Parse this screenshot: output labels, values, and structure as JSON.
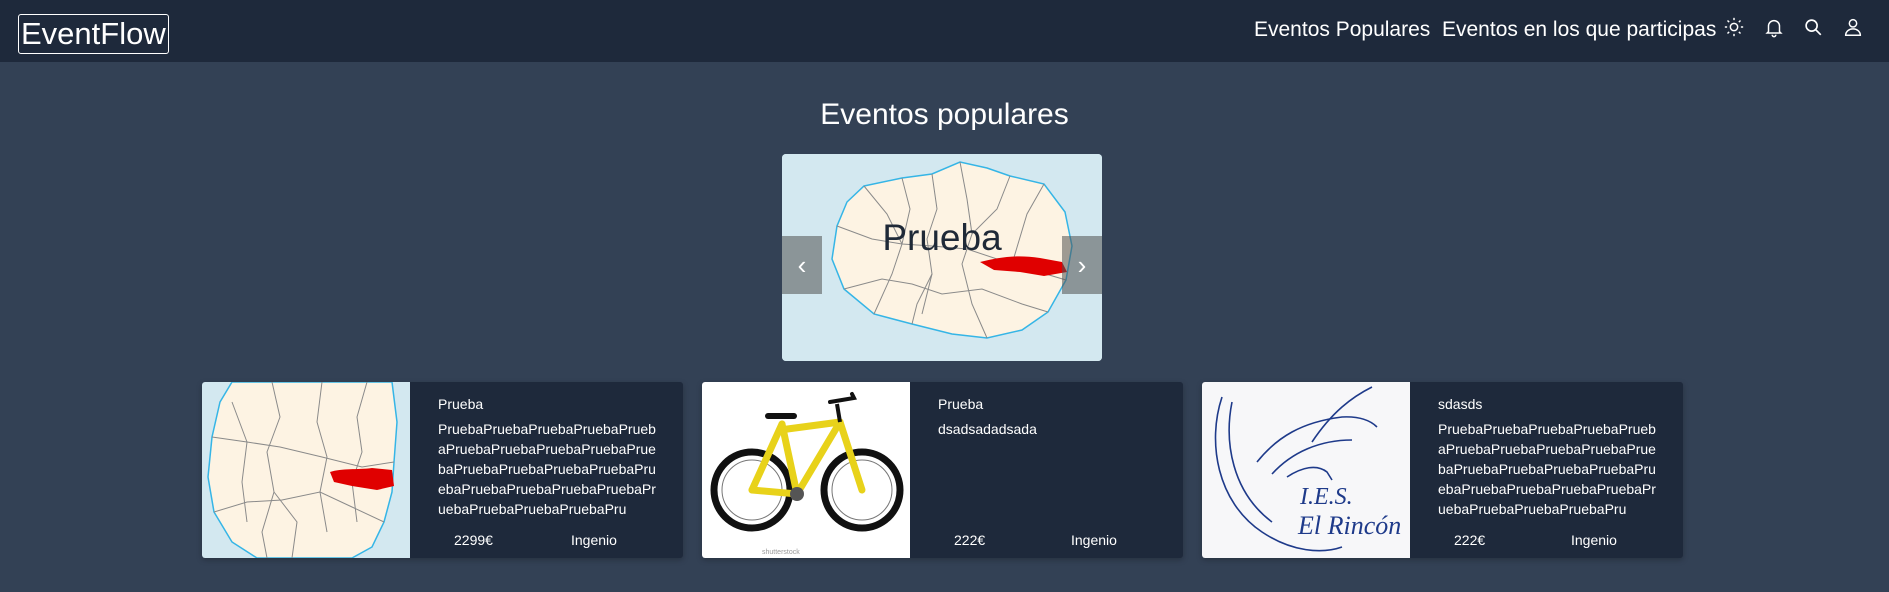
{
  "navbar": {
    "brand": "EventFlow",
    "links": [
      "Eventos Populares",
      "Eventos en los que participas"
    ],
    "icons": [
      "sun-icon",
      "bell-icon",
      "search-icon",
      "user-icon"
    ]
  },
  "main": {
    "title": "Eventos populares",
    "carousel": {
      "caption": "Prueba",
      "prev_label": "‹",
      "next_label": "›"
    },
    "cards": [
      {
        "title": "Prueba",
        "description": "PruebaPruebaPruebaPruebaPruebaPruebaPruebaPruebaPruebaPruebaPruebaPruebaPruebaPruebaPruebaPruebaPruebaPruebaPruebaPruebaPruebaPruebaPruebaPru",
        "price": "2299€",
        "location": "Ingenio",
        "image": "island-map"
      },
      {
        "title": "Prueba",
        "description": "dsadsadadsada",
        "price": "222€",
        "location": "Ingenio",
        "image": "yellow-bicycle"
      },
      {
        "title": "sdasds",
        "description": "PruebaPruebaPruebaPruebaPruebaPruebaPruebaPruebaPruebaPruebaPruebaPruebaPruebaPruebaPruebaPruebaPruebaPruebaPruebaPruebaPruebaPruebaPruebaPru",
        "price": "222€",
        "location": "Ingenio",
        "image": "ies-el-rincon-logo",
        "logo_text": [
          "I.E.S.",
          "El Rincón"
        ]
      }
    ]
  },
  "colors": {
    "navbar_bg": "#1e293b",
    "page_bg": "#334155",
    "card_bg": "#1e293b",
    "map_sea": "#d3e8f0",
    "map_land": "#fdf3e3",
    "map_highlight": "#e00000"
  }
}
